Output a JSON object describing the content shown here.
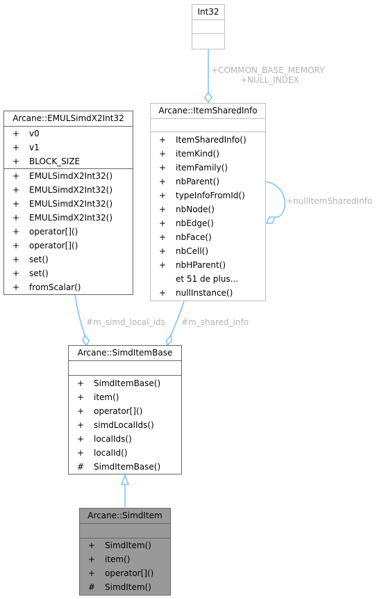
{
  "classes": {
    "int32": {
      "name": "Int32",
      "attributes": [],
      "methods": []
    },
    "item_shared_info": {
      "name": "Arcane::ItemSharedInfo",
      "attributes": [],
      "methods": [
        {
          "vis": "+",
          "name": "ItemSharedInfo()"
        },
        {
          "vis": "+",
          "name": "itemKind()"
        },
        {
          "vis": "+",
          "name": "itemFamily()"
        },
        {
          "vis": "+",
          "name": "nbParent()"
        },
        {
          "vis": "+",
          "name": "typeInfoFromId()"
        },
        {
          "vis": "+",
          "name": "nbNode()"
        },
        {
          "vis": "+",
          "name": "nbEdge()"
        },
        {
          "vis": "+",
          "name": "nbFace()"
        },
        {
          "vis": "+",
          "name": "nbCell()"
        },
        {
          "vis": "+",
          "name": "nbHParent()"
        },
        {
          "vis": "",
          "name": "et 51 de plus..."
        },
        {
          "vis": "+",
          "name": "nullInstance()"
        }
      ]
    },
    "emul_simd": {
      "name": "Arcane::EMULSimdX2Int32",
      "attributes": [
        {
          "vis": "+",
          "name": "v0"
        },
        {
          "vis": "+",
          "name": "v1"
        },
        {
          "vis": "+",
          "name": "BLOCK_SIZE"
        }
      ],
      "methods": [
        {
          "vis": "+",
          "name": "EMULSimdX2Int32()"
        },
        {
          "vis": "+",
          "name": "EMULSimdX2Int32()"
        },
        {
          "vis": "+",
          "name": "EMULSimdX2Int32()"
        },
        {
          "vis": "+",
          "name": "EMULSimdX2Int32()"
        },
        {
          "vis": "+",
          "name": "operator[]()"
        },
        {
          "vis": "+",
          "name": "operator[]()"
        },
        {
          "vis": "+",
          "name": "set()"
        },
        {
          "vis": "+",
          "name": "set()"
        },
        {
          "vis": "+",
          "name": "fromScalar()"
        }
      ]
    },
    "simd_item_base": {
      "name": "Arcane::SimdItemBase",
      "attributes": [],
      "methods": [
        {
          "vis": "+",
          "name": "SimdItemBase()"
        },
        {
          "vis": "+",
          "name": "item()"
        },
        {
          "vis": "+",
          "name": "operator[]()"
        },
        {
          "vis": "+",
          "name": "simdLocalIds()"
        },
        {
          "vis": "+",
          "name": "localIds()"
        },
        {
          "vis": "+",
          "name": "localId()"
        },
        {
          "vis": "#",
          "name": "SimdItemBase()"
        }
      ]
    },
    "simd_item": {
      "name": "Arcane::SimdItem",
      "attributes": [],
      "methods": [
        {
          "vis": "+",
          "name": "SimdItem()"
        },
        {
          "vis": "+",
          "name": "item()"
        },
        {
          "vis": "+",
          "name": "operator[]()"
        },
        {
          "vis": "#",
          "name": "SimdItem()"
        }
      ]
    }
  },
  "edge_labels": {
    "int32_to_shared_1": "+COMMON_BASE_MEMORY",
    "int32_to_shared_2": "+NULL_INDEX",
    "shared_self": "+nullItemSharedInfo",
    "emul_to_base": "#m_simd_local_ids",
    "shared_to_base": "#m_shared_info"
  },
  "colors": {
    "edge": "#63b8ff",
    "label": "#b3b3b3",
    "highlight_fill": "#999999"
  }
}
